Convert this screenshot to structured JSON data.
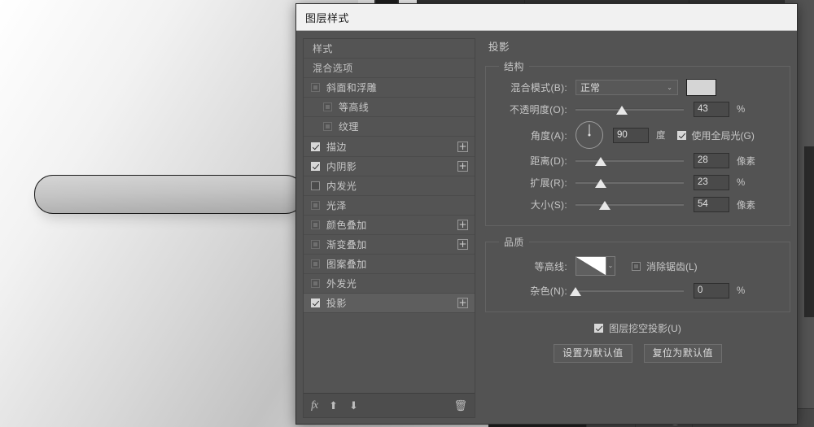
{
  "dialog": {
    "title": "图层样式"
  },
  "effects_panel": {
    "items": [
      {
        "label": "样式",
        "type": "header",
        "checkbox": "none",
        "indent": false,
        "plus": false,
        "selected": false
      },
      {
        "label": "混合选项",
        "type": "header",
        "checkbox": "none",
        "indent": false,
        "plus": false,
        "selected": false
      },
      {
        "label": "斜面和浮雕",
        "type": "effect",
        "checkbox": "disabled",
        "indent": false,
        "plus": false,
        "selected": false
      },
      {
        "label": "等高线",
        "type": "sub",
        "checkbox": "disabled",
        "indent": true,
        "plus": false,
        "selected": false
      },
      {
        "label": "纹理",
        "type": "sub",
        "checkbox": "disabled",
        "indent": true,
        "plus": false,
        "selected": false
      },
      {
        "label": "描边",
        "type": "effect",
        "checkbox": "checked",
        "indent": false,
        "plus": true,
        "selected": false
      },
      {
        "label": "内阴影",
        "type": "effect",
        "checkbox": "checked",
        "indent": false,
        "plus": true,
        "selected": false
      },
      {
        "label": "内发光",
        "type": "effect",
        "checkbox": "unchecked",
        "indent": false,
        "plus": false,
        "selected": false
      },
      {
        "label": "光泽",
        "type": "effect",
        "checkbox": "disabled",
        "indent": false,
        "plus": false,
        "selected": false
      },
      {
        "label": "颜色叠加",
        "type": "effect",
        "checkbox": "disabled",
        "indent": false,
        "plus": true,
        "selected": false
      },
      {
        "label": "渐变叠加",
        "type": "effect",
        "checkbox": "disabled",
        "indent": false,
        "plus": true,
        "selected": false
      },
      {
        "label": "图案叠加",
        "type": "effect",
        "checkbox": "disabled",
        "indent": false,
        "plus": false,
        "selected": false
      },
      {
        "label": "外发光",
        "type": "effect",
        "checkbox": "disabled",
        "indent": false,
        "plus": false,
        "selected": false
      },
      {
        "label": "投影",
        "type": "effect",
        "checkbox": "checked",
        "indent": false,
        "plus": true,
        "selected": true
      }
    ],
    "plus_glyph": "+",
    "footer": {
      "fx_icon": "fx",
      "move_up_icon": "⬆",
      "move_down_icon": "⬇",
      "delete_icon": "🗑"
    }
  },
  "settings": {
    "title": "投影",
    "structure": {
      "legend": "结构",
      "blend_mode": {
        "label": "混合模式(B):",
        "value": "正常",
        "caret": "⌄"
      },
      "color": {
        "swatch_hex": "#d5d5d5"
      },
      "opacity": {
        "label": "不透明度(O):",
        "value": "43",
        "unit": "%",
        "percent": 43
      },
      "angle": {
        "label": "角度(A):",
        "value": "90",
        "unit": "度",
        "degrees": 90
      },
      "use_global_light": {
        "label": "使用全局光(G)",
        "checked": true
      },
      "distance": {
        "label": "距离(D):",
        "value": "28",
        "unit": "像素",
        "percent": 23
      },
      "spread": {
        "label": "扩展(R):",
        "value": "23",
        "unit": "%",
        "percent": 23
      },
      "size": {
        "label": "大小(S):",
        "value": "54",
        "unit": "像素",
        "percent": 27
      }
    },
    "quality": {
      "legend": "品质",
      "contour": {
        "label": "等高线:",
        "caret": "⌄"
      },
      "anti_alias": {
        "label": "消除锯齿(L)",
        "checked": false
      },
      "noise": {
        "label": "杂色(N):",
        "value": "0",
        "unit": "%",
        "percent": 0
      }
    },
    "knockout": {
      "label": "图层挖空投影(U)",
      "checked": true
    },
    "buttons": {
      "set_default": "设置为默认值",
      "reset_default": "复位为默认值"
    }
  },
  "app_chrome": {
    "status_label": "投影"
  }
}
